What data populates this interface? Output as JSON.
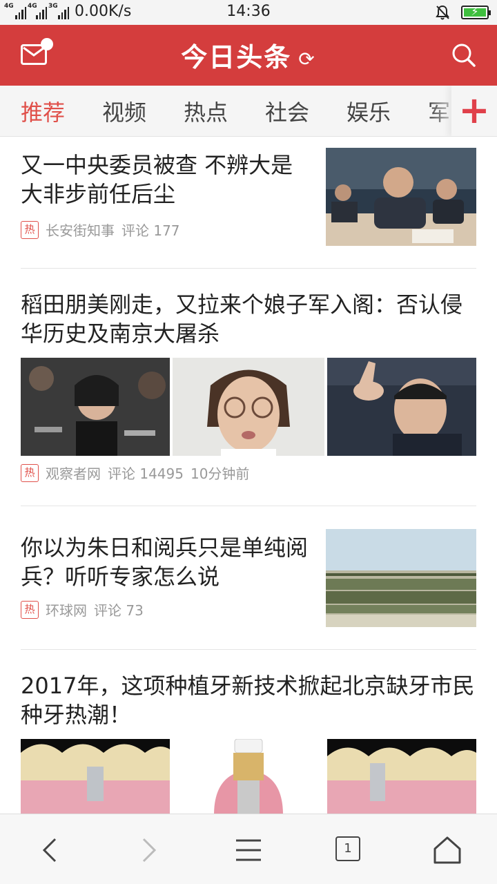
{
  "statusbar": {
    "network1": "4G",
    "network2": "4G",
    "network3": "3G",
    "speed": "0.00K/s",
    "time": "14:36"
  },
  "header": {
    "logo": "今日头条",
    "refresh_icon": "refresh-icon",
    "mail_icon": "mail-icon",
    "search_icon": "search-icon",
    "color": "#d43d3d"
  },
  "tabs": {
    "items": [
      {
        "label": "推荐",
        "active": true
      },
      {
        "label": "视频"
      },
      {
        "label": "热点"
      },
      {
        "label": "社会"
      },
      {
        "label": "娱乐"
      },
      {
        "label": "军"
      }
    ],
    "add_label": "+"
  },
  "feed": [
    {
      "title": "又一中央委员被查 不辨大是大非步前任后尘",
      "hot": "热",
      "source": "长安街知事",
      "comments": "评论 177"
    },
    {
      "title": "稻田朋美刚走，又拉来个娘子军入阁：否认侵华历史及南京大屠杀",
      "hot": "热",
      "source": "观察者网",
      "comments": "评论 14495",
      "time": "10分钟前"
    },
    {
      "title": "你以为朱日和阅兵只是单纯阅兵？听听专家怎么说",
      "hot": "热",
      "source": "环球网",
      "comments": "评论 73"
    },
    {
      "title": "2017年，这项种植牙新技术掀起北京缺牙市民种牙热潮！"
    }
  ],
  "bottombar": {
    "tab_count": "1"
  }
}
